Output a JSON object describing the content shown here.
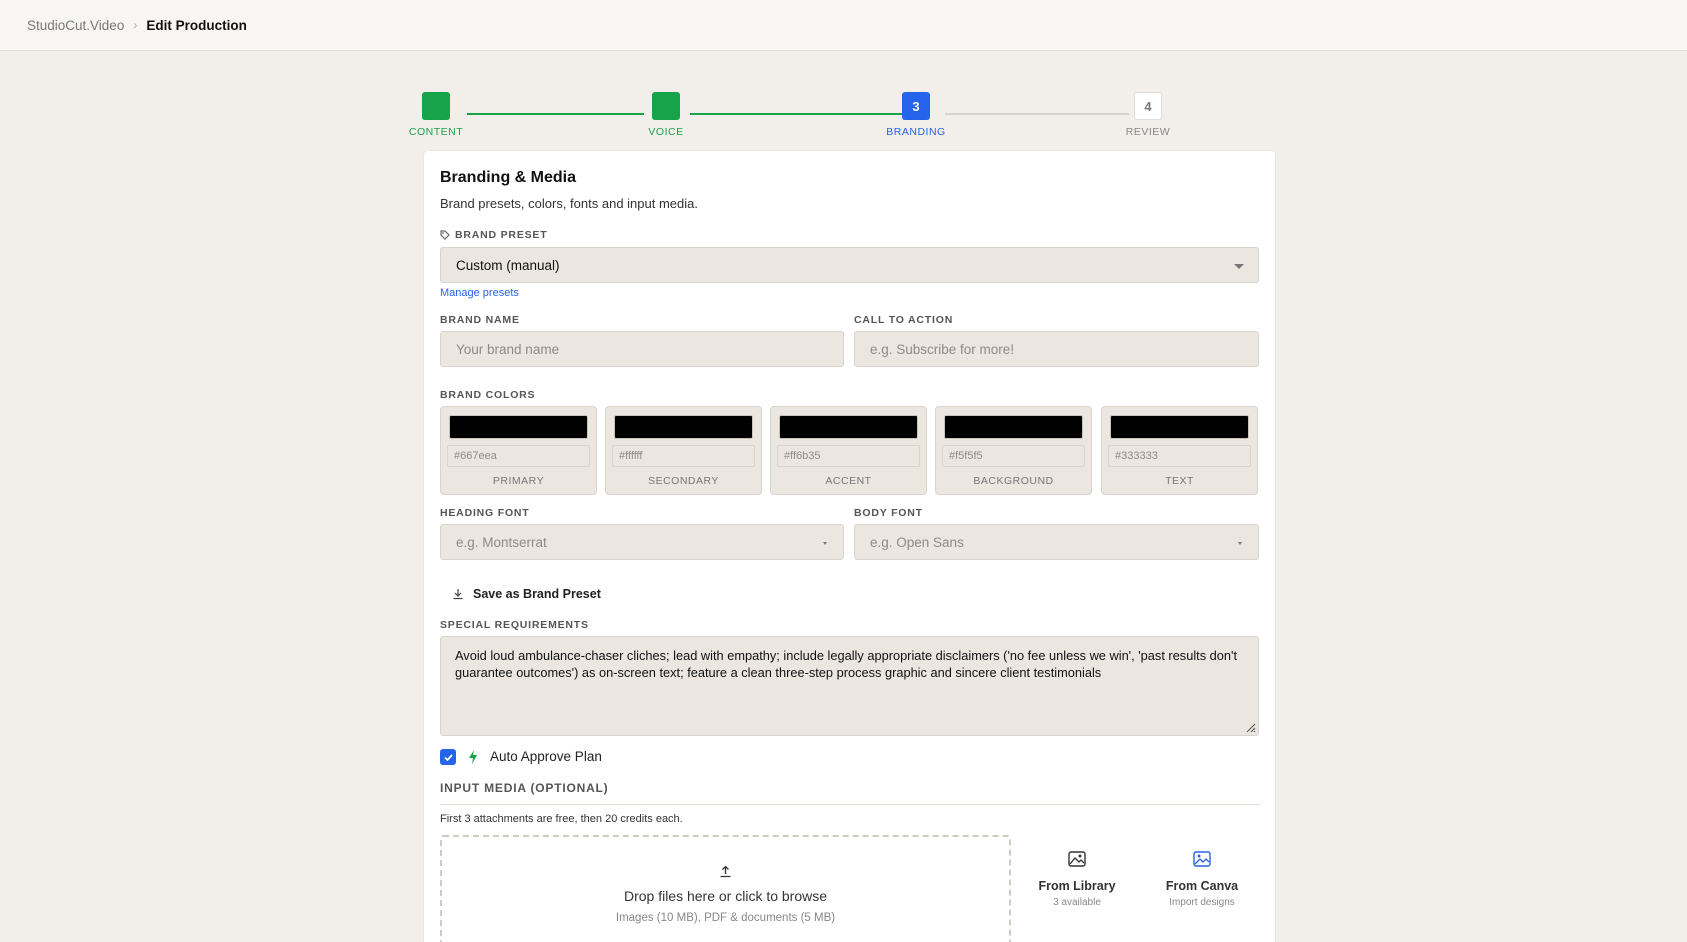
{
  "breadcrumb": {
    "root": "StudioCut.Video",
    "separator": "›",
    "current": "Edit Production"
  },
  "steps": [
    {
      "label": "CONTENT",
      "number": "",
      "state": "done"
    },
    {
      "label": "VOICE",
      "number": "",
      "state": "done"
    },
    {
      "label": "BRANDING",
      "number": "3",
      "state": "active"
    },
    {
      "label": "REVIEW",
      "number": "4",
      "state": "todo"
    }
  ],
  "section": {
    "title": "Branding & Media",
    "subtitle": "Brand presets, colors, fonts and input media."
  },
  "brand_preset": {
    "label": "BRAND PRESET",
    "value": "Custom (manual)",
    "manage_link": "Manage presets"
  },
  "brand_name": {
    "label": "BRAND NAME",
    "placeholder": "Your brand name",
    "value": ""
  },
  "call_to_action": {
    "label": "CALL TO ACTION",
    "placeholder": "e.g. Subscribe for more!",
    "value": ""
  },
  "brand_colors": {
    "label": "BRAND COLORS",
    "items": [
      {
        "name": "PRIMARY",
        "hex": "#667eea"
      },
      {
        "name": "SECONDARY",
        "hex": "#ffffff"
      },
      {
        "name": "ACCENT",
        "hex": "#ff6b35"
      },
      {
        "name": "BACKGROUND",
        "hex": "#f5f5f5"
      },
      {
        "name": "TEXT",
        "hex": "#333333"
      }
    ]
  },
  "heading_font": {
    "label": "HEADING FONT",
    "placeholder": "e.g. Montserrat"
  },
  "body_font": {
    "label": "BODY FONT",
    "placeholder": "e.g. Open Sans"
  },
  "save_preset_label": "Save as Brand Preset",
  "special_requirements": {
    "label": "SPECIAL REQUIREMENTS",
    "value": "Avoid loud ambulance-chaser cliches; lead with empathy; include legally appropriate disclaimers ('no fee unless we win', 'past results don't guarantee outcomes') as on-screen text; feature a clean three-step process graphic and sincere client testimonials"
  },
  "auto_approve": {
    "label": "Auto Approve Plan",
    "checked": true
  },
  "input_media": {
    "title": "INPUT MEDIA (OPTIONAL)",
    "note": "First 3 attachments are free, then 20 credits each.",
    "drop_main": "Drop files here or click to browse",
    "drop_sub": "Images (10 MB), PDF & documents (5 MB)",
    "from_library": {
      "title": "From Library",
      "sub": "3 available"
    },
    "from_canva": {
      "title": "From Canva",
      "sub": "Import designs"
    }
  },
  "colors": {
    "green": "#16a34a",
    "blue": "#2563eb",
    "field_bg": "#ebe6e0",
    "page_bg": "#f2efea"
  }
}
